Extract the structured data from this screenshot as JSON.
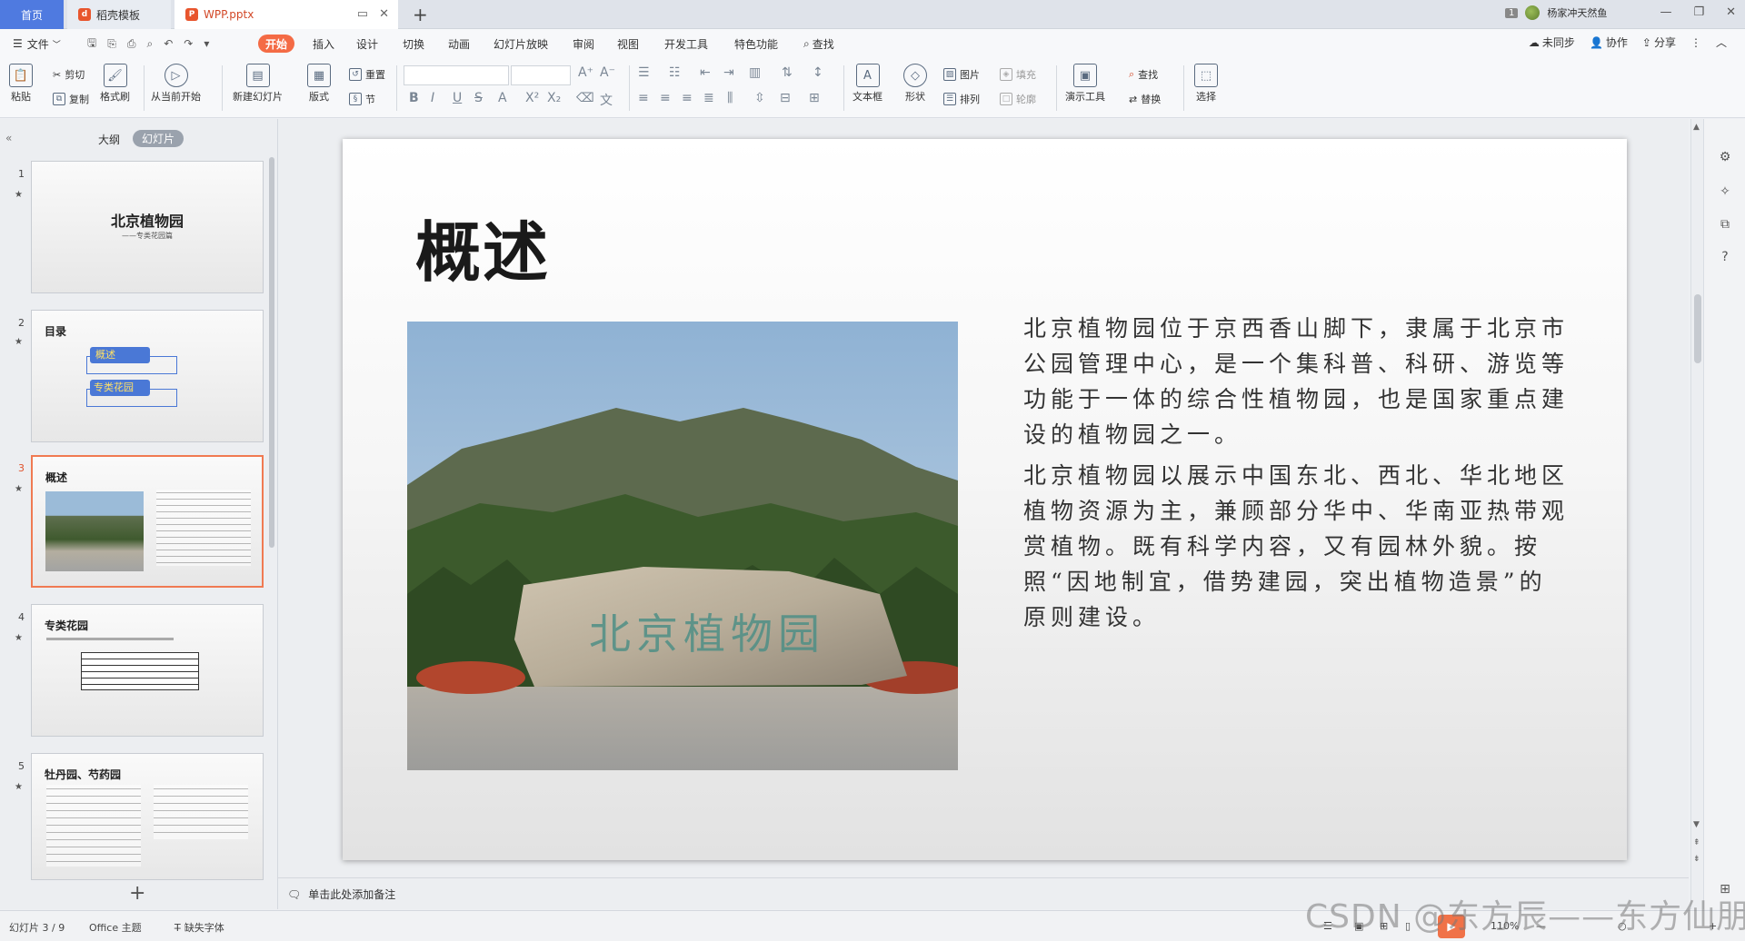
{
  "tabs": {
    "home": "首页",
    "template": "稻壳模板",
    "document": "WPP.pptx",
    "new_tab": "+"
  },
  "account": {
    "badge": "1",
    "name": "杨家冲天然鱼"
  },
  "menu": {
    "file": "文件",
    "items": [
      "开始",
      "插入",
      "设计",
      "切换",
      "动画",
      "幻灯片放映",
      "审阅",
      "视图",
      "开发工具",
      "特色功能"
    ],
    "search": "查找",
    "unsynced": "未同步",
    "collab": "协作",
    "share": "分享"
  },
  "ribbon": {
    "paste": "粘贴",
    "cut": "剪切",
    "copy": "复制",
    "format_painter": "格式刷",
    "from_current": "从当前开始",
    "new_slide": "新建幻灯片",
    "layout": "版式",
    "reset": "重置",
    "section": "节",
    "textbox": "文本框",
    "shape": "形状",
    "picture": "图片",
    "fill": "填充",
    "arrange": "排列",
    "outline": "轮廓",
    "present_tools": "演示工具",
    "find": "查找",
    "replace": "替换",
    "select": "选择"
  },
  "left_panel": {
    "outline_tab": "大纲",
    "slides_tab": "幻灯片",
    "thumbs": [
      {
        "num": "1",
        "title": "北京植物园",
        "subtitle": "——专类花园篇"
      },
      {
        "num": "2",
        "title": "目录",
        "items": [
          "概述",
          "专类花园"
        ]
      },
      {
        "num": "3",
        "title": "概述"
      },
      {
        "num": "4",
        "title": "专类花园"
      },
      {
        "num": "5",
        "title": "牡丹园、芍药园"
      }
    ]
  },
  "slide": {
    "title": "概述",
    "para1": "北京植物园位于京西香山脚下，隶属于北京市公园管理中心，是一个集科普、科研、游览等功能于一体的综合性植物园，也是国家重点建设的植物园之一。",
    "para2": "北京植物园以展示中国东北、西北、华北地区植物资源为主，兼顾部分华中、华南亚热带观赏植物。既有科学内容，又有园林外貌。按照“因地制宜，借势建园，突出植物造景”的原则建设。",
    "stone_text": "北京植物园"
  },
  "notes_placeholder": "单击此处添加备注",
  "status": {
    "slide_counter": "幻灯片 3 / 9",
    "theme": "Office 主题",
    "missing_font": "缺失字体",
    "zoom": "110%"
  },
  "watermark": "CSDN @东方辰——东方仙朋"
}
